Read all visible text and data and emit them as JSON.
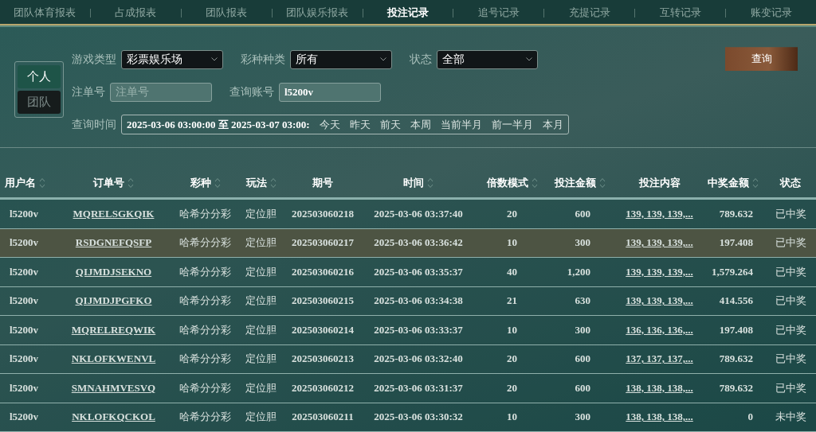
{
  "tabs": [
    {
      "label": "团队体育报表",
      "selected": false
    },
    {
      "label": "占成报表",
      "selected": false
    },
    {
      "label": "团队报表",
      "selected": false
    },
    {
      "label": "团队娱乐报表",
      "selected": false
    },
    {
      "label": "投注记录",
      "selected": true
    },
    {
      "label": "追号记录",
      "selected": false
    },
    {
      "label": "充提记录",
      "selected": false
    },
    {
      "label": "互转记录",
      "selected": false
    },
    {
      "label": "账变记录",
      "selected": false
    }
  ],
  "scope_toggle": [
    {
      "label": "个人",
      "selected": true
    },
    {
      "label": "团队",
      "selected": false
    }
  ],
  "filters": {
    "selects": [
      {
        "label": "游戏类型",
        "value": "彩票娱乐场"
      },
      {
        "label": "彩种种类",
        "value": "所有"
      },
      {
        "label": "状态",
        "value": "全部"
      }
    ],
    "inputs": [
      {
        "label": "注单号",
        "placeholder": "注单号"
      },
      {
        "label": "查询账号",
        "value": "l5200v"
      }
    ],
    "time": {
      "label": "查询时间",
      "value": "2025-03-06 03:00:00 至 2025-03-07 03:00:",
      "presets": [
        "今天",
        "昨天",
        "前天",
        "本周",
        "当前半月",
        "前一半月",
        "本月"
      ]
    },
    "query_button": "查询"
  },
  "table": {
    "columns": [
      {
        "label": "用户名",
        "sortable": true
      },
      {
        "label": "订单号",
        "sortable": true
      },
      {
        "label": "彩种",
        "sortable": true
      },
      {
        "label": "玩法",
        "sortable": true
      },
      {
        "label": "期号",
        "sortable": false
      },
      {
        "label": "时间",
        "sortable": true
      },
      {
        "label": "倍数模式",
        "sortable": true
      },
      {
        "label": "投注金额",
        "sortable": true
      },
      {
        "label": "投注内容",
        "sortable": false
      },
      {
        "label": "中奖金额",
        "sortable": true
      },
      {
        "label": "状态",
        "sortable": false
      }
    ],
    "rows": [
      {
        "selected": false,
        "cells": [
          "l5200v",
          "MQRELSGKQIK",
          "哈希分分彩",
          "定位胆",
          "202503060218",
          "2025-03-06 03:37:40",
          "20",
          "600",
          "139, 139, 139,...",
          "789.632",
          "已中奖"
        ]
      },
      {
        "selected": true,
        "cells": [
          "l5200v",
          "RSDGNEFQSFP",
          "哈希分分彩",
          "定位胆",
          "202503060217",
          "2025-03-06 03:36:42",
          "10",
          "300",
          "139, 139, 139,...",
          "197.408",
          "已中奖"
        ]
      },
      {
        "selected": false,
        "cells": [
          "l5200v",
          "QIJMDJSEKNO",
          "哈希分分彩",
          "定位胆",
          "202503060216",
          "2025-03-06 03:35:37",
          "40",
          "1,200",
          "139, 139, 139,...",
          "1,579.264",
          "已中奖"
        ]
      },
      {
        "selected": false,
        "cells": [
          "l5200v",
          "QIJMDJPGFKO",
          "哈希分分彩",
          "定位胆",
          "202503060215",
          "2025-03-06 03:34:38",
          "21",
          "630",
          "139, 139, 139,...",
          "414.556",
          "已中奖"
        ]
      },
      {
        "selected": false,
        "cells": [
          "l5200v",
          "MQRELREQWIK",
          "哈希分分彩",
          "定位胆",
          "202503060214",
          "2025-03-06 03:33:37",
          "10",
          "300",
          "136, 136, 136,...",
          "197.408",
          "已中奖"
        ]
      },
      {
        "selected": false,
        "cells": [
          "l5200v",
          "NKLOFKWENVL",
          "哈希分分彩",
          "定位胆",
          "202503060213",
          "2025-03-06 03:32:40",
          "20",
          "600",
          "137, 137, 137,...",
          "789.632",
          "已中奖"
        ]
      },
      {
        "selected": false,
        "cells": [
          "l5200v",
          "SMNAHMVESVQ",
          "哈希分分彩",
          "定位胆",
          "202503060212",
          "2025-03-06 03:31:37",
          "20",
          "600",
          "138, 138, 138,...",
          "789.632",
          "已中奖"
        ]
      },
      {
        "selected": false,
        "cells": [
          "l5200v",
          "NKLOFKQCKOL",
          "哈希分分彩",
          "定位胆",
          "202503060211",
          "2025-03-06 03:30:32",
          "10",
          "300",
          "138, 138, 138,...",
          "0",
          "未中奖"
        ]
      }
    ]
  }
}
